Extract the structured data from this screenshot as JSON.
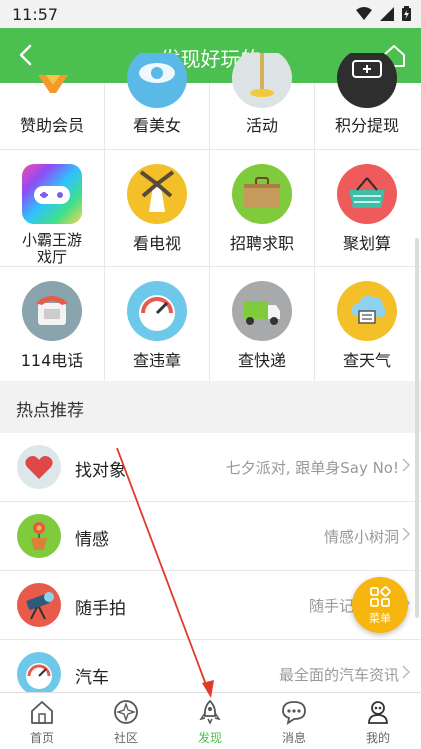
{
  "status": {
    "time": "11:57"
  },
  "header": {
    "title": "发现好玩的"
  },
  "grid": {
    "row0": [
      "赞助会员",
      "看美女",
      "活动",
      "积分提现"
    ],
    "row1": [
      {
        "label": "小霸王游\n戏厅",
        "icon": "gamepad-icon"
      },
      {
        "label": "看电视",
        "icon": "windmill-icon"
      },
      {
        "label": "招聘求职",
        "icon": "briefcase-icon"
      },
      {
        "label": "聚划算",
        "icon": "basket-icon"
      }
    ],
    "row2": [
      {
        "label": "114电话",
        "icon": "telephone-icon"
      },
      {
        "label": "查违章",
        "icon": "speedometer-icon"
      },
      {
        "label": "查快递",
        "icon": "truck-icon"
      },
      {
        "label": "查天气",
        "icon": "cloud-icon"
      }
    ]
  },
  "section": {
    "title": "热点推荐"
  },
  "list": [
    {
      "label": "找对象",
      "sub": "七夕派对, 跟单身Say No!",
      "icon": "heart-icon"
    },
    {
      "label": "情感",
      "sub": "情感小树洞",
      "icon": "flowerpot-icon"
    },
    {
      "label": "随手拍",
      "sub": "随手记录生活",
      "icon": "telescope-icon"
    },
    {
      "label": "汽车",
      "sub": "最全面的汽车资讯",
      "icon": "gauge-icon"
    }
  ],
  "fab": {
    "label": "菜单"
  },
  "tabs": [
    {
      "label": "首页",
      "icon": "home-icon"
    },
    {
      "label": "社区",
      "icon": "compass-icon"
    },
    {
      "label": "发现",
      "icon": "rocket-icon"
    },
    {
      "label": "消息",
      "icon": "chat-icon"
    },
    {
      "label": "我的",
      "icon": "profile-icon"
    }
  ],
  "colors": {
    "brand": "#4bbf4f",
    "fab": "#f7b50f",
    "annotation": "#e03a2a"
  }
}
